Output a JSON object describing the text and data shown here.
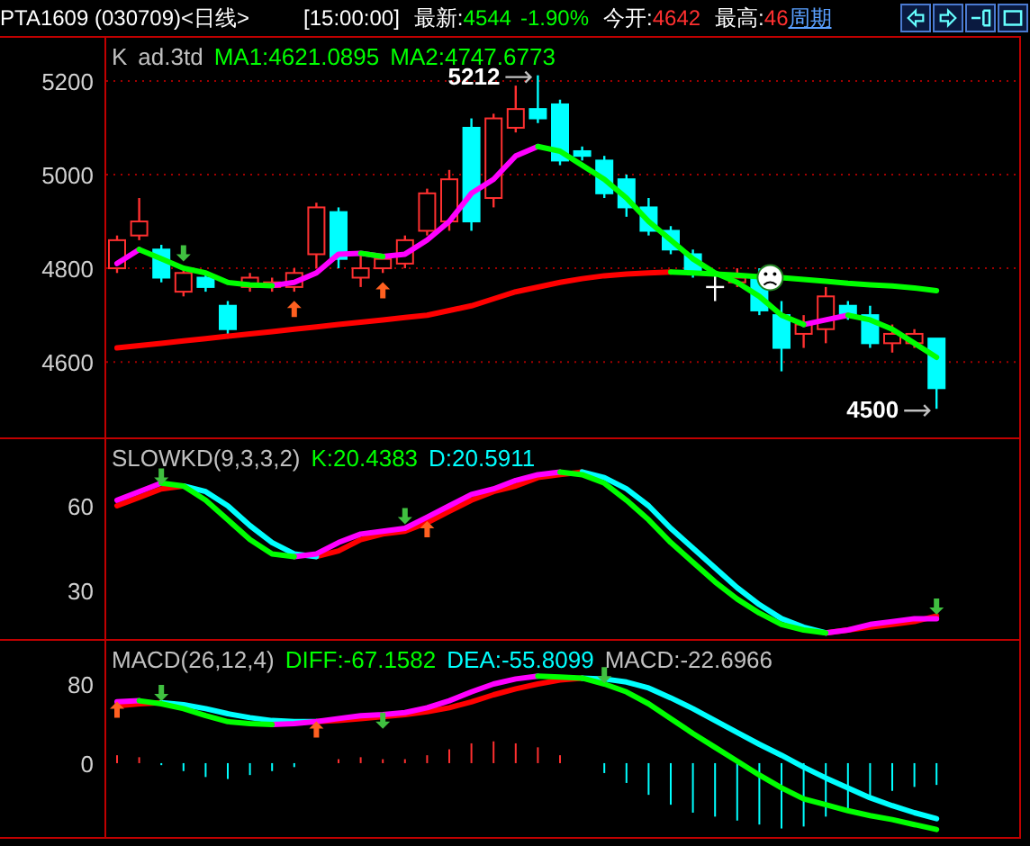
{
  "top_bar": [
    {
      "kind": "text",
      "text": "PTA1609 (030709)<日线>",
      "color": "#ffffff"
    },
    {
      "kind": "text",
      "text": "[15:00:00]",
      "color": "#ffffff"
    },
    {
      "kind": "text",
      "text": "最新:",
      "color": "#ffffff"
    },
    {
      "kind": "text",
      "text": "4544",
      "color": "#00ff00"
    },
    {
      "kind": "text",
      "text": "-1.90%",
      "color": "#00ff00"
    },
    {
      "kind": "text",
      "text": "今开:",
      "color": "#ffffff"
    },
    {
      "kind": "text",
      "text": "4642",
      "color": "#ff3030"
    },
    {
      "kind": "text",
      "text": "最高:",
      "color": "#ffffff"
    },
    {
      "kind": "text",
      "text": "46",
      "color": "#ff3030"
    },
    {
      "kind": "link",
      "text": "周期",
      "color": "#5aa0ff"
    }
  ],
  "toolbar_buttons": [
    {
      "kind": "left"
    },
    {
      "kind": "right"
    },
    {
      "kind": "split"
    },
    {
      "kind": "window"
    }
  ],
  "panels": [
    {
      "legend": [
        {
          "text": "K",
          "color": "#c0c0c0"
        },
        {
          "text": "ad.3td",
          "color": "#c0c0c0"
        },
        {
          "text": "MA1:4621.0895",
          "color": "#00ff00"
        },
        {
          "text": "MA2:4747.6773",
          "color": "#00ff00"
        }
      ],
      "price_labels": [
        {
          "kind": "high",
          "text": "5212"
        },
        {
          "kind": "low",
          "text": "4500"
        }
      ],
      "chart_data": {
        "type": "candlestick",
        "ylim": [
          4437,
          5294
        ],
        "yticks": [
          4600,
          4800,
          5000,
          5200
        ],
        "grid": true,
        "categories": [
          null,
          null,
          null,
          null,
          null,
          null,
          null,
          null,
          null,
          null,
          null,
          null,
          null,
          null,
          null,
          null,
          null,
          null,
          null,
          null,
          null,
          null,
          null,
          null,
          null,
          null,
          null,
          null,
          null,
          null,
          null,
          null,
          null,
          null,
          null,
          null,
          null,
          null
        ],
        "ohlc": [
          [
            4800,
            4870,
            4790,
            4860
          ],
          [
            4870,
            4950,
            4860,
            4900
          ],
          [
            4840,
            4850,
            4770,
            4780
          ],
          [
            4750,
            4800,
            4740,
            4790
          ],
          [
            4780,
            4790,
            4750,
            4760
          ],
          [
            4720,
            4730,
            4650,
            4670
          ],
          [
            4760,
            4790,
            4750,
            4780
          ],
          [
            4760,
            4780,
            4750,
            4770
          ],
          [
            4760,
            4800,
            4750,
            4790
          ],
          [
            4830,
            4940,
            4800,
            4930
          ],
          [
            4920,
            4930,
            4800,
            4820
          ],
          [
            4780,
            4830,
            4760,
            4800
          ],
          [
            4800,
            4830,
            4790,
            4820
          ],
          [
            4810,
            4870,
            4800,
            4860
          ],
          [
            4880,
            4970,
            4870,
            4960
          ],
          [
            4900,
            5010,
            4880,
            4990
          ],
          [
            5100,
            5120,
            4880,
            4900
          ],
          [
            4950,
            5130,
            4930,
            5120
          ],
          [
            5100,
            5190,
            5090,
            5140
          ],
          [
            5140,
            5212,
            5110,
            5120
          ],
          [
            5150,
            5160,
            5020,
            5030
          ],
          [
            5050,
            5060,
            5030,
            5040
          ],
          [
            5030,
            5040,
            4950,
            4960
          ],
          [
            4990,
            5000,
            4910,
            4930
          ],
          [
            4930,
            4950,
            4870,
            4880
          ],
          [
            4880,
            4890,
            4830,
            4840
          ],
          [
            4830,
            4840,
            4780,
            4790
          ],
          [
            4760,
            4790,
            4730,
            4760
          ],
          [
            4770,
            4800,
            4760,
            4780
          ],
          [
            4780,
            4800,
            4700,
            4710
          ],
          [
            4700,
            4730,
            4580,
            4630
          ],
          [
            4660,
            4700,
            4630,
            4680
          ],
          [
            4670,
            4760,
            4640,
            4740
          ],
          [
            4720,
            4730,
            4690,
            4700
          ],
          [
            4700,
            4720,
            4630,
            4640
          ],
          [
            4640,
            4680,
            4620,
            4660
          ],
          [
            4640,
            4670,
            4630,
            4660
          ],
          [
            4650,
            4650,
            4500,
            4544
          ]
        ],
        "series": [
          {
            "type": "line",
            "color": "#ff00ff",
            "values": [
              4810,
              4840,
              null,
              null,
              null,
              null,
              null,
              4763,
              4770,
              4790,
              4830,
              4832,
              4825,
              4830,
              4860,
              4900,
              4960,
              4990,
              5040,
              5060,
              null,
              null,
              null,
              null,
              null,
              null,
              null,
              null,
              null,
              null,
              null,
              4680,
              4690,
              4700,
              null,
              null,
              null,
              null
            ]
          },
          {
            "type": "line",
            "color": "#00ff00",
            "values": [
              null,
              4840,
              4820,
              4800,
              4790,
              4770,
              4765,
              4763,
              null,
              null,
              null,
              4832,
              4825,
              null,
              null,
              null,
              null,
              null,
              null,
              5060,
              5050,
              5020,
              4990,
              4950,
              4900,
              4860,
              4820,
              4790,
              4770,
              4740,
              4700,
              4680,
              null,
              4700,
              4690,
              4670,
              4640,
              4610
            ]
          },
          {
            "type": "line",
            "color": "#ff0000",
            "values": [
              4630,
              4635,
              4640,
              4645,
              4650,
              4655,
              4660,
              4665,
              4670,
              4675,
              4680,
              4685,
              4690,
              4695,
              4700,
              4710,
              4720,
              4735,
              4750,
              4760,
              4770,
              4778,
              4784,
              4788,
              4790,
              4792,
              null,
              null,
              null,
              null,
              null,
              null,
              null,
              null,
              null,
              null,
              null,
              null
            ]
          },
          {
            "type": "line",
            "color": "#00ff00",
            "values": [
              null,
              null,
              null,
              null,
              null,
              null,
              null,
              null,
              null,
              null,
              null,
              null,
              null,
              null,
              null,
              null,
              null,
              null,
              null,
              null,
              null,
              null,
              null,
              null,
              null,
              4792,
              4790,
              4788,
              4785,
              4782,
              4780,
              4776,
              4772,
              4768,
              4765,
              4762,
              4758,
              4752
            ]
          }
        ]
      }
    },
    {
      "legend": [
        {
          "text": "SLOWKD(9,3,3,2)",
          "color": "#c0c0c0"
        },
        {
          "text": "K:20.4383",
          "color": "#00ff00"
        },
        {
          "text": "D:20.5911",
          "color": "#00ffff"
        }
      ],
      "chart_data": {
        "type": "line",
        "ylim": [
          12.5,
          83.9
        ],
        "yticks": [
          30,
          60
        ],
        "categories": [
          null,
          null,
          null,
          null,
          null,
          null,
          null,
          null,
          null,
          null,
          null,
          null,
          null,
          null,
          null,
          null,
          null,
          null,
          null,
          null,
          null,
          null,
          null,
          null,
          null,
          null,
          null,
          null,
          null,
          null,
          null,
          null,
          null,
          null,
          null,
          null,
          null,
          null
        ],
        "series": [
          {
            "color": "#ff0000",
            "values": [
              60,
              63,
              66,
              67,
              null,
              null,
              null,
              null,
              null,
              42,
              44,
              48,
              50,
              51,
              54,
              58,
              62,
              65,
              67,
              70,
              71,
              72,
              null,
              null,
              null,
              null,
              null,
              null,
              null,
              null,
              null,
              null,
              15,
              16,
              17,
              18,
              19,
              21
            ]
          },
          {
            "color": "#00ffff",
            "values": [
              null,
              null,
              null,
              67,
              65,
              60,
              53,
              47,
              43,
              42,
              null,
              null,
              null,
              null,
              null,
              null,
              null,
              null,
              null,
              null,
              null,
              72,
              70,
              66,
              60,
              52,
              45,
              38,
              31,
              25,
              20,
              17,
              15,
              null,
              null,
              null,
              null,
              null
            ]
          },
          {
            "color": "#ff00ff",
            "values": [
              62,
              65,
              68,
              null,
              null,
              null,
              null,
              null,
              42,
              43,
              47,
              50,
              51,
              52,
              56,
              60,
              64,
              66,
              69,
              71,
              72,
              null,
              null,
              null,
              null,
              null,
              null,
              null,
              null,
              null,
              null,
              null,
              15,
              16,
              18,
              19,
              20,
              20
            ]
          },
          {
            "color": "#00ff00",
            "values": [
              null,
              null,
              68,
              67,
              62,
              55,
              48,
              43,
              42,
              null,
              null,
              null,
              null,
              null,
              null,
              null,
              null,
              null,
              null,
              null,
              72,
              71,
              68,
              62,
              55,
              47,
              40,
              33,
              27,
              22,
              18,
              16,
              15,
              null,
              null,
              null,
              null,
              null
            ]
          }
        ]
      }
    },
    {
      "legend": [
        {
          "text": "MACD(26,12,4)",
          "color": "#c0c0c0"
        },
        {
          "text": "DIFF:-67.1582",
          "color": "#00ff00"
        },
        {
          "text": "DEA:-55.8099",
          "color": "#00ffff"
        },
        {
          "text": "MACD:-22.6966",
          "color": "#c0c0c0"
        }
      ],
      "chart_data": {
        "type": "line",
        "ylim": [
          -75.5,
          124.5
        ],
        "yticks": [
          0,
          80
        ],
        "categories": [
          null,
          null,
          null,
          null,
          null,
          null,
          null,
          null,
          null,
          null,
          null,
          null,
          null,
          null,
          null,
          null,
          null,
          null,
          null,
          null,
          null,
          null,
          null,
          null,
          null,
          null,
          null,
          null,
          null,
          null,
          null,
          null,
          null,
          null,
          null,
          null,
          null,
          null
        ],
        "series": [
          {
            "type": "bar",
            "color": "#ff3030",
            "values": [
              8,
              6,
              null,
              null,
              null,
              null,
              null,
              null,
              null,
              null,
              4,
              6,
              4,
              4,
              8,
              14,
              20,
              22,
              20,
              16,
              8,
              null,
              null,
              null,
              null,
              null,
              null,
              null,
              null,
              null,
              null,
              null,
              null,
              null,
              null,
              null,
              null,
              null
            ]
          },
          {
            "type": "bar",
            "color": "#00ffff",
            "values": [
              null,
              null,
              -2,
              -8,
              -14,
              -16,
              -12,
              -8,
              -4,
              null,
              null,
              null,
              null,
              null,
              null,
              null,
              null,
              null,
              null,
              null,
              null,
              null,
              -10,
              -20,
              -32,
              -42,
              -50,
              -54,
              -58,
              -62,
              -66,
              -64,
              -54,
              -46,
              -36,
              -28,
              -24,
              -22
            ]
          },
          {
            "type": "line",
            "color": "#ff0000",
            "values": [
              58,
              60,
              61,
              null,
              null,
              null,
              null,
              null,
              null,
              42,
              43,
              45,
              47,
              49,
              52,
              56,
              62,
              69,
              75,
              80,
              84,
              86,
              null,
              null,
              null,
              null,
              null,
              null,
              null,
              null,
              null,
              null,
              null,
              null,
              null,
              null,
              null,
              null
            ]
          },
          {
            "type": "line",
            "color": "#00ffff",
            "values": [
              null,
              null,
              61,
              59,
              55,
              50,
              46,
              43,
              42,
              42,
              null,
              null,
              null,
              null,
              null,
              null,
              null,
              null,
              null,
              null,
              null,
              86,
              85,
              82,
              76,
              66,
              55,
              43,
              31,
              19,
              8,
              -4,
              -15,
              -25,
              -35,
              -43,
              -50,
              -56
            ]
          },
          {
            "type": "line",
            "color": "#ff00ff",
            "values": [
              62,
              63,
              null,
              null,
              null,
              null,
              null,
              39,
              40,
              42,
              45,
              48,
              49,
              51,
              56,
              63,
              72,
              80,
              85,
              88,
              null,
              null,
              null,
              null,
              null,
              null,
              null,
              null,
              null,
              null,
              null,
              null,
              null,
              null,
              null,
              null,
              null,
              null
            ]
          },
          {
            "type": "line",
            "color": "#00ff00",
            "values": [
              null,
              63,
              60,
              55,
              48,
              42,
              40,
              39,
              null,
              null,
              null,
              null,
              null,
              null,
              null,
              null,
              null,
              null,
              null,
              88,
              87,
              86,
              80,
              72,
              60,
              45,
              30,
              16,
              2,
              -12,
              -25,
              -36,
              -42,
              -48,
              -53,
              -57,
              -62,
              -67
            ]
          }
        ]
      }
    }
  ]
}
